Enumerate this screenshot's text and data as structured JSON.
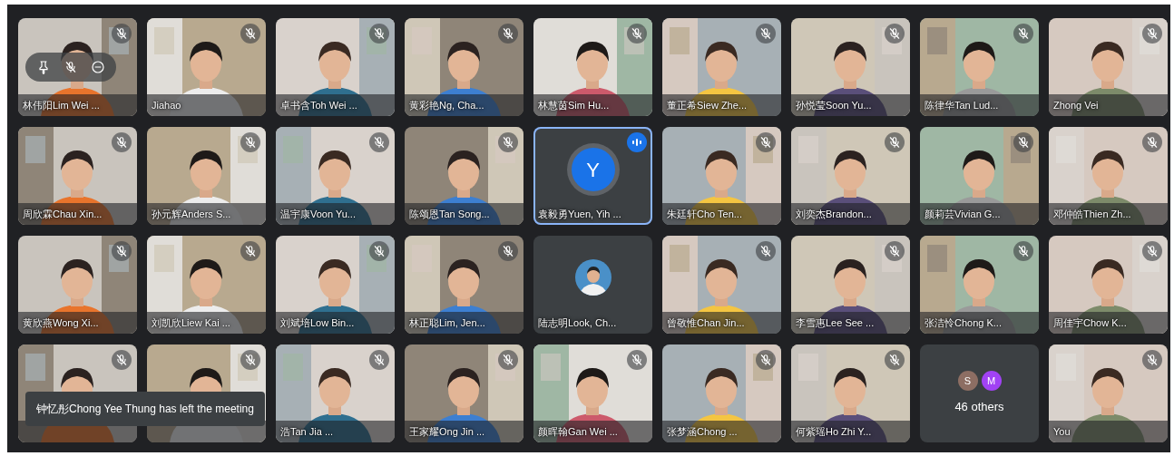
{
  "tiles": [
    {
      "kind": "video",
      "name": "林伟阳Lim Wei ...",
      "muted": true,
      "speaking": false,
      "hovered": true
    },
    {
      "kind": "video",
      "name": "Jiahao",
      "muted": true,
      "speaking": false,
      "hovered": false
    },
    {
      "kind": "video",
      "name": "卓书含Toh Wei ...",
      "muted": true,
      "speaking": false,
      "hovered": false
    },
    {
      "kind": "video",
      "name": "黄彩艳Ng, Cha...",
      "muted": true,
      "speaking": false,
      "hovered": false
    },
    {
      "kind": "video",
      "name": "林慧茵Sim Hu...",
      "muted": true,
      "speaking": false,
      "hovered": false
    },
    {
      "kind": "video",
      "name": "董正希Siew Zhe...",
      "muted": true,
      "speaking": false,
      "hovered": false
    },
    {
      "kind": "video",
      "name": "孙悦莹Soon Yu...",
      "muted": true,
      "speaking": false,
      "hovered": false
    },
    {
      "kind": "video",
      "name": "陈律华Tan Lud...",
      "muted": true,
      "speaking": false,
      "hovered": false
    },
    {
      "kind": "video",
      "name": "Zhong Vei",
      "muted": true,
      "speaking": false,
      "hovered": false
    },
    {
      "kind": "video",
      "name": "周欣霖Chau Xin...",
      "muted": true,
      "speaking": false,
      "hovered": false
    },
    {
      "kind": "video",
      "name": "孙元辉Anders S...",
      "muted": true,
      "speaking": false,
      "hovered": false
    },
    {
      "kind": "video",
      "name": "温宇康Voon Yu...",
      "muted": true,
      "speaking": false,
      "hovered": false
    },
    {
      "kind": "video",
      "name": "陈颂恩Tan Song...",
      "muted": true,
      "speaking": false,
      "hovered": false
    },
    {
      "kind": "initial",
      "initial": "Y",
      "name": "袁毅勇Yuen, Yih ...",
      "muted": false,
      "speaking": true,
      "hovered": false
    },
    {
      "kind": "video",
      "name": "朱廷轩Cho Ten...",
      "muted": true,
      "speaking": false,
      "hovered": false
    },
    {
      "kind": "video",
      "name": "刘奕杰Brandon...",
      "muted": true,
      "speaking": false,
      "hovered": false
    },
    {
      "kind": "video",
      "name": "颜莉芸Vivian G...",
      "muted": true,
      "speaking": false,
      "hovered": false
    },
    {
      "kind": "video",
      "name": "邓仲皓Thien Zh...",
      "muted": true,
      "speaking": false,
      "hovered": false
    },
    {
      "kind": "video",
      "name": "黄欣燕Wong Xi...",
      "muted": true,
      "speaking": false,
      "hovered": false
    },
    {
      "kind": "video",
      "name": "刘凯欣Liew Kai ...",
      "muted": true,
      "speaking": false,
      "hovered": false
    },
    {
      "kind": "video",
      "name": "刘斌培Low Bin...",
      "muted": true,
      "speaking": false,
      "hovered": false
    },
    {
      "kind": "video",
      "name": "林正聪Lim, Jen...",
      "muted": true,
      "speaking": false,
      "hovered": false
    },
    {
      "name": "陆志明Look, Ch...",
      "muted": false,
      "speaking": false,
      "hovered": false
    },
    {
      "kind": "video",
      "name": "曾敬惟Chan Jin...",
      "muted": true,
      "speaking": false,
      "hovered": false
    },
    {
      "kind": "video",
      "name": "李雪惠Lee See ...",
      "muted": true,
      "speaking": false,
      "hovered": false
    },
    {
      "kind": "video",
      "name": "张洁怜Chong K...",
      "muted": true,
      "speaking": false,
      "hovered": false
    },
    {
      "kind": "video",
      "name": "周佳宇Chow K...",
      "muted": true,
      "speaking": false,
      "hovered": false
    },
    {
      "kind": "video",
      "muted": true,
      "speaking": false,
      "hovered": false
    },
    {
      "kind": "video",
      "muted": true,
      "speaking": false,
      "hovered": false
    },
    {
      "kind": "video",
      "name": "浩Tan Jia ...",
      "muted": true,
      "speaking": false,
      "hovered": false
    },
    {
      "kind": "video",
      "name": "王家耀Ong Jin ...",
      "muted": true,
      "speaking": false,
      "hovered": false
    },
    {
      "kind": "video",
      "name": "颜晖翰Gan Wei ...",
      "muted": true,
      "speaking": false,
      "hovered": false
    },
    {
      "kind": "video",
      "name": "张梦涵Chong ...",
      "muted": true,
      "speaking": false,
      "hovered": false
    },
    {
      "kind": "video",
      "name": "何紫瑶Ho Zhi Y...",
      "muted": true,
      "speaking": false,
      "hovered": false
    },
    {
      "kind": "others",
      "avatars": [
        {
          "letter": "S",
          "color": "#8d6e63"
        },
        {
          "letter": "M",
          "color": "#a142f4"
        }
      ],
      "name": "46 others",
      "muted": false,
      "speaking": false,
      "hovered": false
    },
    {
      "kind": "video",
      "name": "You",
      "muted": true,
      "speaking": false,
      "hovered": false
    }
  ],
  "toast": "钟忆彤Chong Yee Thung has left the meeting"
}
